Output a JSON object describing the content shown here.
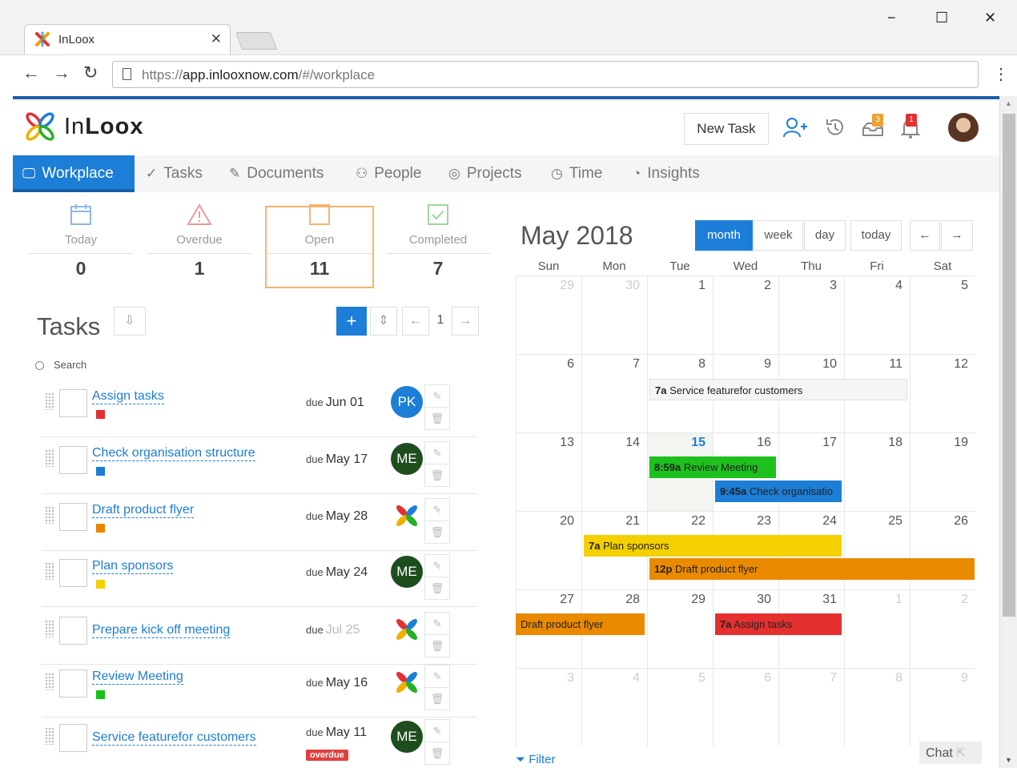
{
  "browser": {
    "tab_title": "InLoox",
    "url_host": "app.inlooxnow.com",
    "url_scheme": "https://",
    "url_path": "/#/workplace",
    "win_min": "−",
    "win_max": "☐",
    "win_close": "✕",
    "tab_close": "✕"
  },
  "app": {
    "logo_prefix": "In",
    "logo_suffix": "Loox",
    "new_task_label": "New Task",
    "tasks_badge": "3",
    "alerts_badge": "1"
  },
  "nav": {
    "items": [
      {
        "label": "Workplace",
        "icon": "monitor-icon"
      },
      {
        "label": "Tasks",
        "icon": "check-icon"
      },
      {
        "label": "Documents",
        "icon": "paperclip-icon"
      },
      {
        "label": "People",
        "icon": "person-icon"
      },
      {
        "label": "Projects",
        "icon": "target-icon"
      },
      {
        "label": "Time",
        "icon": "clock-icon"
      },
      {
        "label": "Insights",
        "icon": "pie-chart-icon"
      }
    ]
  },
  "stats": [
    {
      "label": "Today",
      "value": "0",
      "color": "#8fb8e6"
    },
    {
      "label": "Overdue",
      "value": "1",
      "color": "#e99"
    },
    {
      "label": "Open",
      "value": "11",
      "color": "#f4b56b"
    },
    {
      "label": "Completed",
      "value": "7",
      "color": "#9dd89d"
    }
  ],
  "tasks": {
    "title": "Tasks",
    "search_placeholder": "Search",
    "page": "1",
    "overdue_label": "overdue",
    "due_prefix": "due",
    "rows": [
      {
        "name": "Assign tasks",
        "due": "Jun 01",
        "color": "#e53030",
        "avatar": "PK",
        "avatar_bg": "#1c7ed6"
      },
      {
        "name": "Check organisation structure",
        "due": "May 17",
        "color": "#1c7ed6",
        "avatar": "ME",
        "avatar_bg": "#1e4d1e"
      },
      {
        "name": "Draft product flyer",
        "due": "May 28",
        "color": "#ea8500",
        "avatar": "",
        "avatar_bg": ""
      },
      {
        "name": "Plan sponsors",
        "due": "May 24",
        "color": "#f5d000",
        "avatar": "ME",
        "avatar_bg": "#1e4d1e"
      },
      {
        "name": "Prepare kick off meeting",
        "due": "Jul 25",
        "color": "",
        "avatar": "",
        "avatar_bg": ""
      },
      {
        "name": "Review Meeting",
        "due": "May 16",
        "color": "#15c015",
        "avatar": "",
        "avatar_bg": ""
      },
      {
        "name": "Service featurefor customers",
        "due": "May 11",
        "color": "",
        "avatar": "ME",
        "avatar_bg": "#1e4d1e"
      }
    ]
  },
  "calendar": {
    "title": "May 2018",
    "view_buttons": [
      "month",
      "week",
      "day"
    ],
    "today_label": "today",
    "prev": "←",
    "next": "→",
    "days_of_week": [
      "Sun",
      "Mon",
      "Tue",
      "Wed",
      "Thu",
      "Fri",
      "Sat"
    ],
    "weeks": [
      [
        "29",
        "30",
        "1",
        "2",
        "3",
        "4",
        "5"
      ],
      [
        "6",
        "7",
        "8",
        "9",
        "10",
        "11",
        "12"
      ],
      [
        "13",
        "14",
        "15",
        "16",
        "17",
        "18",
        "19"
      ],
      [
        "20",
        "21",
        "22",
        "23",
        "24",
        "25",
        "26"
      ],
      [
        "27",
        "28",
        "29",
        "30",
        "31",
        "1",
        "2"
      ],
      [
        "3",
        "4",
        "5",
        "6",
        "7",
        "8",
        "9"
      ]
    ],
    "events": [
      {
        "time": "7a",
        "title": "Service featurefor customers",
        "color": "#f5f5f5"
      },
      {
        "time": "8:59a",
        "title": "Review Meeting",
        "color": "#1dc01d"
      },
      {
        "time": "9:45a",
        "title": "Check organisatio",
        "color": "#1c7ed6"
      },
      {
        "time": "7a",
        "title": "Plan sponsors",
        "color": "#f5d000"
      },
      {
        "time": "12p",
        "title": "Draft product flyer",
        "color": "#ea8a00"
      },
      {
        "time": "",
        "title": "Draft product flyer",
        "color": "#ea8a00"
      },
      {
        "time": "7a",
        "title": "Assign tasks",
        "color": "#e53030"
      }
    ],
    "filter_label": "Filter",
    "chat_label": "Chat"
  }
}
